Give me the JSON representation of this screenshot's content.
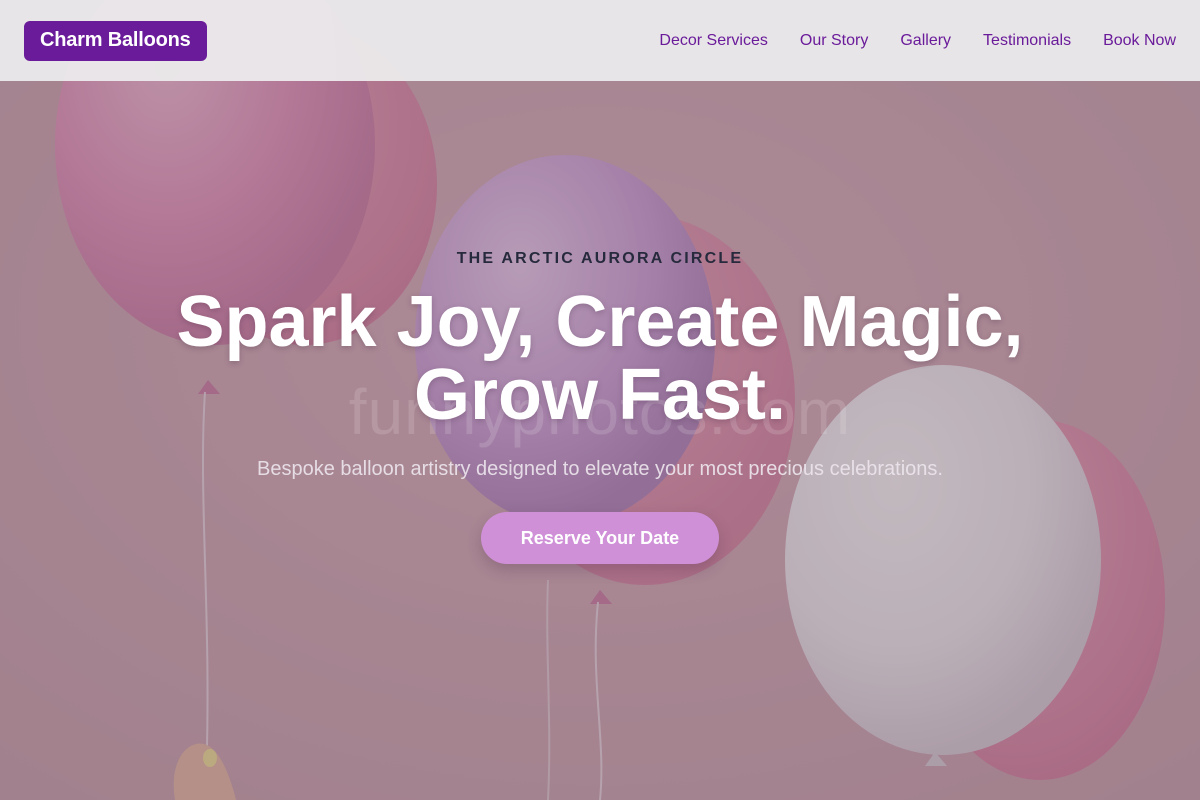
{
  "navbar": {
    "brand": "Charm Balloons",
    "links": [
      {
        "label": "Decor Services"
      },
      {
        "label": "Our Story"
      },
      {
        "label": "Gallery"
      },
      {
        "label": "Testimonials"
      },
      {
        "label": "Book Now"
      }
    ]
  },
  "hero": {
    "eyebrow": "THE ARCTIC AURORA CIRCLE",
    "headline_line1": "Spark Joy, Create Magic,",
    "headline_line2": "Grow Fast.",
    "subtitle": "Bespoke balloon artistry designed to elevate your most precious celebrations.",
    "cta_label": "Reserve Your Date",
    "watermark": "funnyphotos.com"
  },
  "colors": {
    "brand_purple": "#6a1b9a",
    "cta_pink": "#cf90d8",
    "nav_bg": "#eae8ea",
    "eyebrow_text": "#262a3c"
  },
  "background": {
    "subject": "hand holding pink, lavender and white balloons against a pink wall"
  }
}
